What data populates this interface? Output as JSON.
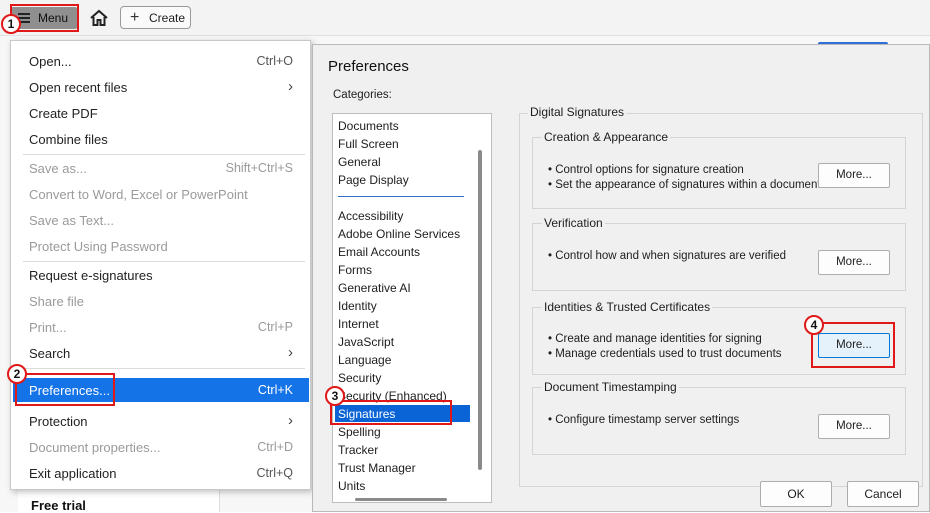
{
  "toolbar": {
    "menu_label": "Menu",
    "create_label": "Create"
  },
  "background": {
    "free_trial": "Free trial"
  },
  "menu": {
    "open": {
      "label": "Open...",
      "shortcut": "Ctrl+O"
    },
    "open_recent": {
      "label": "Open recent files"
    },
    "create_pdf": {
      "label": "Create PDF"
    },
    "combine": {
      "label": "Combine files"
    },
    "save_as": {
      "label": "Save as...",
      "shortcut": "Shift+Ctrl+S"
    },
    "convert": {
      "label": "Convert to Word, Excel or PowerPoint"
    },
    "save_text": {
      "label": "Save as Text..."
    },
    "protect_pw": {
      "label": "Protect Using Password"
    },
    "request_sign": {
      "label": "Request e-signatures"
    },
    "share": {
      "label": "Share file"
    },
    "print": {
      "label": "Print...",
      "shortcut": "Ctrl+P"
    },
    "search": {
      "label": "Search"
    },
    "preferences": {
      "label": "Preferences...",
      "shortcut": "Ctrl+K"
    },
    "protection": {
      "label": "Protection"
    },
    "doc_props": {
      "label": "Document properties...",
      "shortcut": "Ctrl+D"
    },
    "exit": {
      "label": "Exit application",
      "shortcut": "Ctrl+Q"
    }
  },
  "dialog": {
    "title": "Preferences",
    "categories_label": "Categories:",
    "categories": [
      "Documents",
      "Full Screen",
      "General",
      "Page Display",
      "Accessibility",
      "Adobe Online Services",
      "Email Accounts",
      "Forms",
      "Generative AI",
      "Identity",
      "Internet",
      "JavaScript",
      "Language",
      "Security",
      "Security (Enhanced)",
      "Signatures",
      "Spelling",
      "Tracker",
      "Trust Manager",
      "Units"
    ],
    "selected_category": "Signatures",
    "section_title": "Digital Signatures",
    "creation": {
      "title": "Creation & Appearance",
      "line1": "• Control options for signature creation",
      "line2": "• Set the appearance of signatures within a document",
      "button": "More..."
    },
    "verification": {
      "title": "Verification",
      "line1": "• Control how and when signatures are verified",
      "button": "More..."
    },
    "identities": {
      "title": "Identities & Trusted Certificates",
      "line1": "• Create and manage identities for signing",
      "line2": "• Manage credentials used to trust documents",
      "button": "More..."
    },
    "timestamp": {
      "title": "Document Timestamping",
      "line1": "• Configure timestamp server settings",
      "button": "More..."
    },
    "ok": "OK",
    "cancel": "Cancel"
  },
  "annotations": {
    "step1": "1",
    "step2": "2",
    "step3": "3",
    "step4": "4",
    "color": "#e01818"
  }
}
